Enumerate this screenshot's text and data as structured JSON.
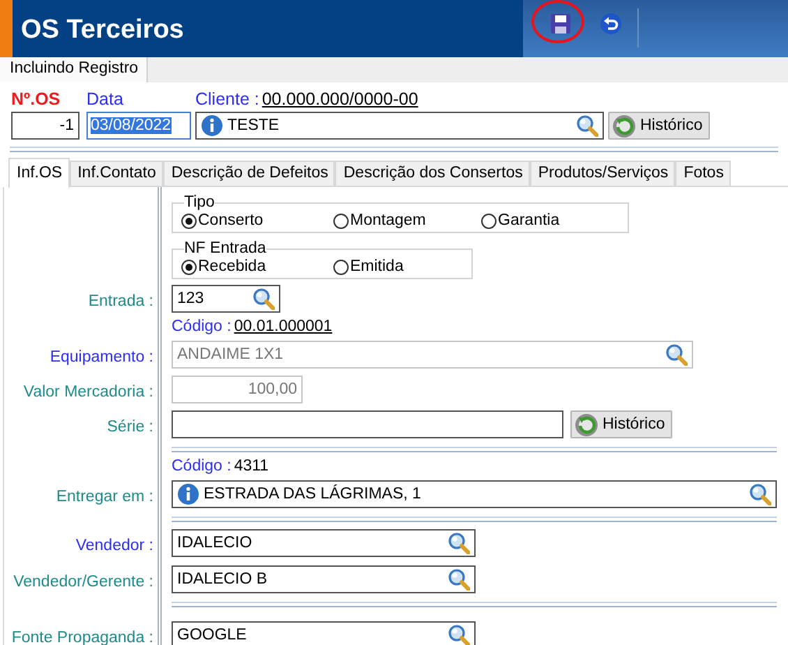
{
  "window": {
    "title": "OS Terceiros"
  },
  "toolbar": [
    {
      "kind": "save",
      "highlighted": true
    },
    {
      "kind": "back"
    }
  ],
  "mode_tab": {
    "label": "Incluindo Registro"
  },
  "header": {
    "os_number": {
      "label": "Nº.OS",
      "value": "-1"
    },
    "date": {
      "label": "Data",
      "value": "03/08/2022",
      "selected": true
    },
    "client": {
      "label": "Cliente :",
      "code": "00.000.000/0000-00",
      "value": "TESTE"
    },
    "history_button": "Histórico"
  },
  "tabs": [
    {
      "label": "Inf.OS",
      "selected": true
    },
    {
      "label": "Inf.Contato",
      "selected": false
    },
    {
      "label": "Descrição de Defeitos",
      "selected": false
    },
    {
      "label": "Descrição dos Consertos",
      "selected": false
    },
    {
      "label": "Produtos/Serviços",
      "selected": false
    },
    {
      "label": "Fotos",
      "selected": false
    }
  ],
  "form": [
    {
      "kind": "radio_group",
      "legend": "Tipo",
      "options": [
        {
          "label": "Conserto",
          "selected": true
        },
        {
          "label": "Montagem",
          "selected": false
        },
        {
          "label": "Garantia",
          "selected": false
        }
      ]
    },
    {
      "kind": "radio_group",
      "legend": "NF Entrada",
      "options": [
        {
          "label": "Recebida",
          "selected": true
        },
        {
          "label": "Emitida",
          "selected": false
        }
      ]
    },
    {
      "kind": "lookup",
      "label": "Entrada :",
      "required": false,
      "value": "123",
      "disabled": false
    },
    {
      "kind": "code",
      "label": "Código :",
      "code": "00.01.000001",
      "link": true
    },
    {
      "kind": "lookup",
      "label": "Equipamento :",
      "required": true,
      "value": "ANDAIME 1X1",
      "disabled": true
    },
    {
      "kind": "number",
      "label": "Valor Mercadoria :",
      "required": false,
      "value": "100,00",
      "disabled": true
    },
    {
      "kind": "field_button",
      "label": "Série :",
      "required": false,
      "button": "Histórico"
    },
    {
      "kind": "separator"
    },
    {
      "kind": "code",
      "label": "Código :",
      "code": "4311",
      "link": false
    },
    {
      "kind": "lookup",
      "label": "Entregar em :",
      "required": false,
      "value": "ESTRADA DAS LÁGRIMAS, 1",
      "disabled": false,
      "info": true
    },
    {
      "kind": "separator"
    },
    {
      "kind": "lookup",
      "label": "Vendedor :",
      "required": true,
      "value": "IDALECIO",
      "disabled": false
    },
    {
      "kind": "lookup",
      "label": "Vendedor/Gerente :",
      "required": false,
      "value": "IDALECIO B",
      "disabled": false
    },
    {
      "kind": "separator"
    },
    {
      "kind": "lookup",
      "label": "Fonte Propaganda :",
      "required": false,
      "value": "GOOGLE",
      "disabled": false
    }
  ]
}
